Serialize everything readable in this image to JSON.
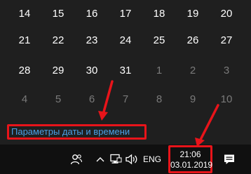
{
  "calendar": {
    "rows": [
      [
        {
          "day": "14",
          "dim": false
        },
        {
          "day": "15",
          "dim": false
        },
        {
          "day": "16",
          "dim": false
        },
        {
          "day": "17",
          "dim": false
        },
        {
          "day": "18",
          "dim": false
        },
        {
          "day": "19",
          "dim": false
        },
        {
          "day": "20",
          "dim": false
        }
      ],
      [
        {
          "day": "21",
          "dim": false
        },
        {
          "day": "22",
          "dim": false
        },
        {
          "day": "23",
          "dim": false
        },
        {
          "day": "24",
          "dim": false
        },
        {
          "day": "25",
          "dim": false
        },
        {
          "day": "26",
          "dim": false
        },
        {
          "day": "27",
          "dim": false
        }
      ],
      [
        {
          "day": "28",
          "dim": false
        },
        {
          "day": "29",
          "dim": false
        },
        {
          "day": "30",
          "dim": false
        },
        {
          "day": "31",
          "dim": false
        },
        {
          "day": "1",
          "dim": true
        },
        {
          "day": "2",
          "dim": true
        },
        {
          "day": "3",
          "dim": true
        }
      ],
      [
        {
          "day": "4",
          "dim": true
        },
        {
          "day": "5",
          "dim": true
        },
        {
          "day": "6",
          "dim": true
        },
        {
          "day": "7",
          "dim": true
        },
        {
          "day": "8",
          "dim": true
        },
        {
          "day": "9",
          "dim": true
        },
        {
          "day": "10",
          "dim": true
        }
      ]
    ]
  },
  "settings_link": {
    "label": "Параметры даты и времени"
  },
  "taskbar": {
    "lang": "ENG",
    "clock": {
      "time": "21:06",
      "date": "03.01.2019"
    },
    "icons": [
      "people-icon",
      "chevron-up-icon",
      "network-icon",
      "volume-icon",
      "notification-icon"
    ]
  },
  "colors": {
    "background": "#1f1f1f",
    "taskbar": "#101010",
    "link": "#4aa0e6",
    "highlight": "#e8141a",
    "dim_text": "#7a7a7a"
  }
}
